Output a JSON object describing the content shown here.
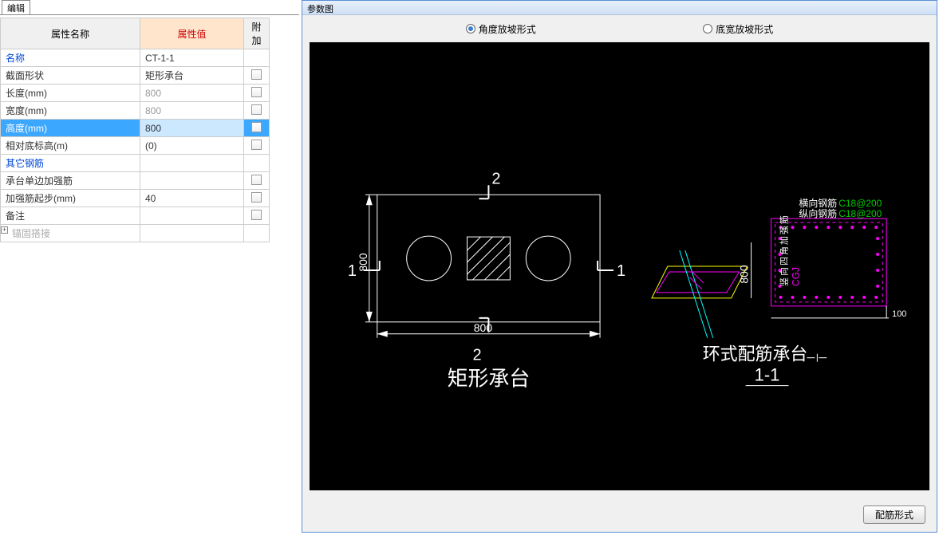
{
  "tabs": {
    "edit": "编辑"
  },
  "table": {
    "headers": {
      "name": "属性名称",
      "value": "属性值",
      "attach": "附加"
    },
    "rows": [
      {
        "name": "名称",
        "value": "CT-1-1",
        "blue": true,
        "attach": false
      },
      {
        "name": "截面形状",
        "value": "矩形承台",
        "attach": true
      },
      {
        "name": "长度(mm)",
        "value": "800",
        "gray": true,
        "attach": true
      },
      {
        "name": "宽度(mm)",
        "value": "800",
        "gray": true,
        "attach": true
      },
      {
        "name": "高度(mm)",
        "value": "800",
        "selected": true,
        "attach": true
      },
      {
        "name": "相对底标高(m)",
        "value": "(0)",
        "attach": true
      },
      {
        "name": "其它钢筋",
        "value": "",
        "blue": true
      },
      {
        "name": "承台单边加强筋",
        "value": "",
        "attach": true
      },
      {
        "name": "加强筋起步(mm)",
        "value": "40",
        "attach": true
      },
      {
        "name": "备注",
        "value": "",
        "attach": true
      },
      {
        "name": "锚固搭接",
        "value": "",
        "anchor": true,
        "expand": true
      }
    ]
  },
  "right": {
    "title": "参数图",
    "radio1": "角度放坡形式",
    "radio2": "底宽放坡形式",
    "button": "配筋形式"
  },
  "drawing": {
    "dim_h": "800",
    "dim_v": "800",
    "sec_num": "2",
    "sec_num2": "1",
    "title_left": "矩形承台",
    "title_right_top": "环式配筋承台",
    "title_right_bot": "1-1",
    "dim_right_v": "800",
    "dim_right_bot": "100",
    "label_hx": "横向钢筋",
    "val_hx": "C18@200",
    "label_zx": "纵向钢筋",
    "val_zx": "C18@200",
    "label_cgj": "CGJ",
    "vert_txt": "竖向四角加强筋"
  }
}
